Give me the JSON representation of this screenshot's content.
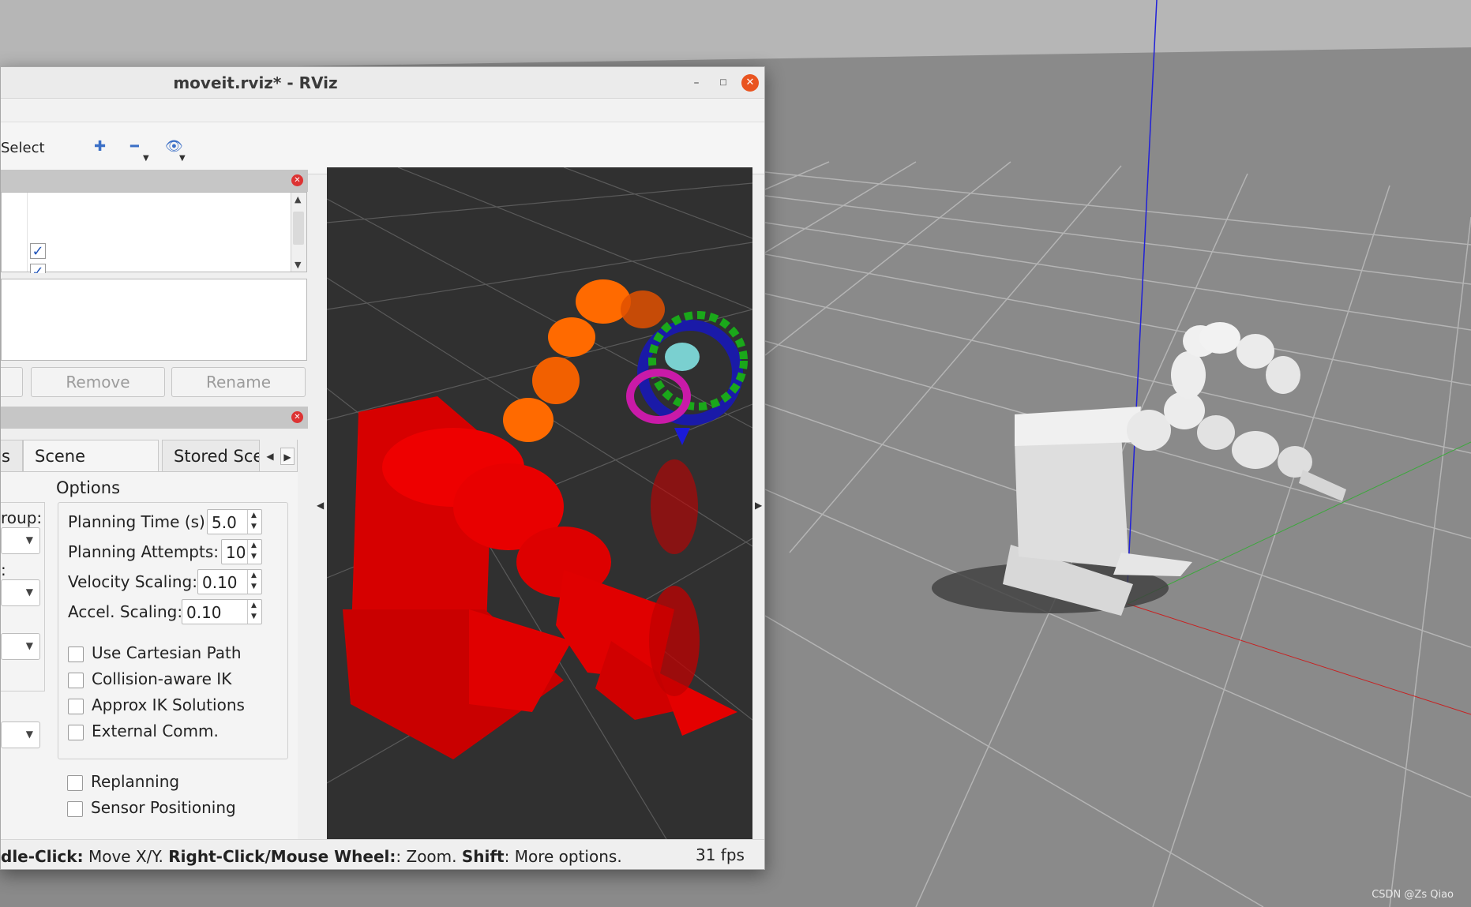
{
  "window": {
    "title": "moveit.rviz* - RViz",
    "minimize_glyph": "–",
    "maximize_glyph": "□",
    "close_glyph": "✕"
  },
  "toolbar": {
    "select_label": "Select",
    "add_icon": "plus-icon",
    "remove_icon": "minus-icon",
    "eye_icon": "eye-icon"
  },
  "displays_panel": {
    "checked_glyph": "✓",
    "buttons": {
      "remove": "Remove",
      "rename": "Rename"
    }
  },
  "motion_planning": {
    "tabs": {
      "fragment": "s",
      "scene_objects": "Scene Objects",
      "stored_scenes": "Stored Sce"
    },
    "options_title": "Options",
    "left_fragments": {
      "group": "roup:",
      "colon": ":"
    },
    "planning_time": {
      "label": "Planning Time (s):",
      "value": "5.0"
    },
    "planning_attempts": {
      "label": "Planning Attempts:",
      "value": "10"
    },
    "velocity_scaling": {
      "label": "Velocity Scaling:",
      "value": "0.10"
    },
    "accel_scaling": {
      "label": "Accel. Scaling:",
      "value": "0.10"
    },
    "checkboxes": [
      "Use Cartesian Path",
      "Collision-aware IK",
      "Approx IK Solutions",
      "External Comm.",
      "Replanning",
      "Sensor Positioning"
    ]
  },
  "status": {
    "seg1_bold": "dle-Click:",
    "seg1": " Move X/Y. ",
    "seg2_bold": "Right-Click/Mouse Wheel:",
    "seg2": ": Zoom. ",
    "seg3_bold": "Shift",
    "seg3": ": More options.",
    "fps": "31 fps"
  },
  "watermark": "CSDN @Zs Qiao",
  "colors": {
    "robot_red": "#e00000",
    "robot_orange": "#ff6a00",
    "robot_white": "#e6e6e6",
    "close_button": "#e95420"
  }
}
